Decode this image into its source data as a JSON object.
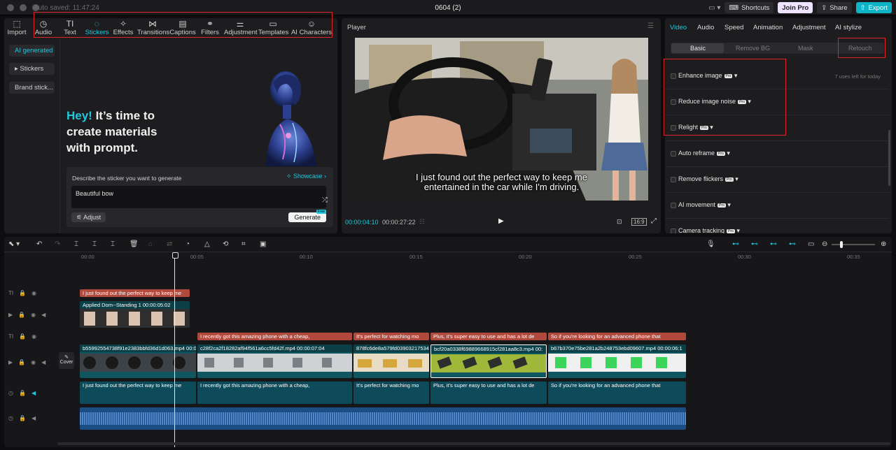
{
  "titlebar": {
    "autosave": "Auto saved: 11:47:24",
    "project_name": "0604 (2)",
    "shortcuts": "Shortcuts",
    "join_pro": "Join Pro",
    "share": "Share",
    "export": "Export"
  },
  "toolbar": [
    {
      "label": "Import",
      "icon": "import-icon"
    },
    {
      "label": "Audio",
      "icon": "audio-icon"
    },
    {
      "label": "Text",
      "icon": "text-icon"
    },
    {
      "label": "Stickers",
      "icon": "stickers-icon"
    },
    {
      "label": "Effects",
      "icon": "effects-icon"
    },
    {
      "label": "Transitions",
      "icon": "transitions-icon"
    },
    {
      "label": "Captions",
      "icon": "captions-icon"
    },
    {
      "label": "Filters",
      "icon": "filters-icon"
    },
    {
      "label": "Adjustment",
      "icon": "adjustment-icon"
    },
    {
      "label": "Templates",
      "icon": "templates-icon"
    },
    {
      "label": "AI Characters",
      "icon": "ai-characters-icon"
    }
  ],
  "sidebar": {
    "items": [
      {
        "label": "AI generated",
        "active": true
      },
      {
        "label": "▸ Stickers"
      },
      {
        "label": "Brand stick..."
      }
    ]
  },
  "stickers": {
    "hero_accent": "Hey!",
    "hero_line1": " It’s time to",
    "hero_line2": "create materials",
    "hero_line3": "with prompt.",
    "prompt_label": "Describe the sticker you want to generate",
    "showcase": "Showcase",
    "prompt_value": "Beautiful bow",
    "adjust": "Adjust",
    "generate": "Generate",
    "free_badge": "Free"
  },
  "player": {
    "title": "Player",
    "subtitle_line1": "I just found out the perfect way to keep me",
    "subtitle_line2": "entertained in the car while I'm driving.",
    "current_time": "00:00:04:10",
    "duration": "00:00:27:22",
    "ratio": "16:9"
  },
  "inspector": {
    "tabs": [
      "Video",
      "Audio",
      "Speed",
      "Animation",
      "Adjustment",
      "AI stylize"
    ],
    "subtabs": [
      "Basic",
      "Remove BG",
      "Mask",
      "Retouch"
    ],
    "uses_left": "7 uses left for today",
    "options": [
      "Enhance image",
      "Reduce image noise",
      "Relight",
      "Auto reframe",
      "Remove flickers",
      "AI movement",
      "Camera tracking"
    ],
    "pro_badge": "Pro"
  },
  "timeline": {
    "ruler": [
      "00:00",
      "00:05",
      "00:10",
      "00:15",
      "00:20",
      "00:25",
      "00:30",
      "00:35"
    ],
    "cover": "Cover",
    "overlay_text": "I just found out the perfect way to keep me",
    "overlay_video": "Applied  Dom--Standing 1  00:00:05:02",
    "text_clips": [
      "I recently got this amazing phone with a cheap,",
      "It's perfect for watching mo",
      "Plus, it's super easy to use and has a lot de",
      "So if you're looking for an advanced phone that"
    ],
    "video_clips": [
      "b55992554738f91e2383bbfd36d1d063.mp4  00:00:0",
      "c28f2ca2f18282af94f561a6cc5fd42f.mp4  00:00:07:04",
      "878fc6de8a579fd039032175340",
      "bcf20a0338f69889668915cf281aa8c3.mp4  00:",
      "b67b370e75be281a2b248753ebd09607.mp4  00:00:06:1"
    ],
    "audio_clips": [
      "I just found out the perfect way to keep me",
      "I recently got this amazing phone with a cheap,",
      "It's perfect for watching mo",
      "Plus, it's super easy to use and has a lot de",
      "So if you're looking for an advanced phone that"
    ]
  },
  "colors": {
    "accent": "#20c7dd",
    "highlight": "#e0242b",
    "text_clip": "#b14a3d",
    "video_clip": "#0f5660",
    "audio_clip": "#0e4b5a",
    "bg_audio": "#1b4c84"
  }
}
